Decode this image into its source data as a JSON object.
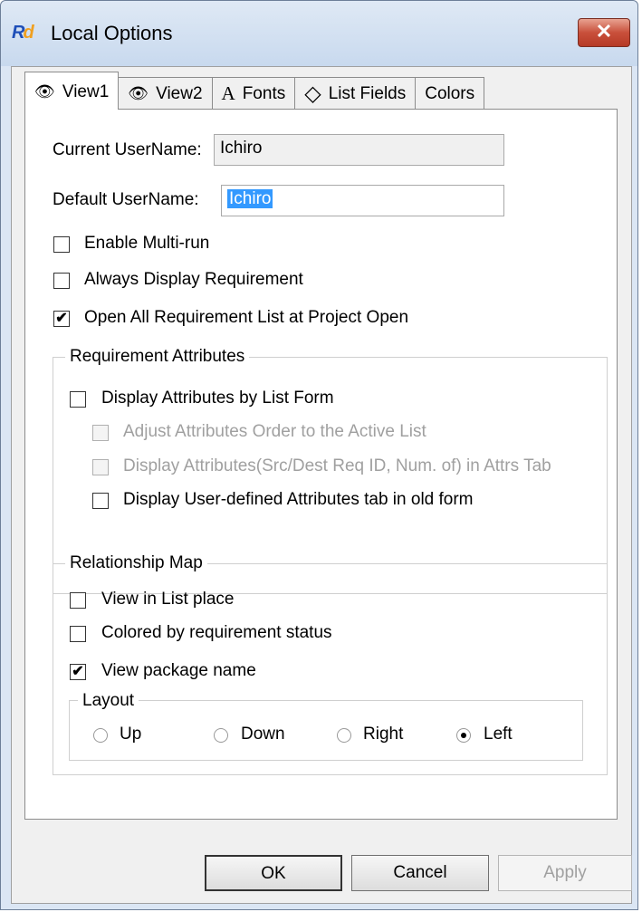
{
  "window": {
    "title": "Local Options",
    "close_glyph": "✕",
    "app_icon": "rd-app-icon"
  },
  "tabs": [
    {
      "label": "View1",
      "icon": "eye-icon",
      "active": true
    },
    {
      "label": "View2",
      "icon": "eye-icon",
      "active": false
    },
    {
      "label": "Fonts",
      "icon": "font-icon",
      "active": false
    },
    {
      "label": "List Fields",
      "icon": "diamond-icon",
      "active": false
    },
    {
      "label": "Colors",
      "icon": "",
      "active": false
    }
  ],
  "view1": {
    "current_username_label": "Current UserName:",
    "current_username_value": "Ichiro",
    "default_username_label": "Default UserName:",
    "default_username_value": "Ichiro",
    "options": [
      {
        "label": "Enable Multi-run",
        "checked": false
      },
      {
        "label": "Always Display Requirement",
        "checked": false
      },
      {
        "label": "Open All Requirement List at Project Open",
        "checked": true
      }
    ],
    "requirement_attributes": {
      "title": "Requirement Attributes",
      "items": [
        {
          "label": "Display Attributes by List Form",
          "checked": false,
          "enabled": true
        },
        {
          "label": "Adjust Attributes Order to the Active List",
          "checked": false,
          "enabled": false
        },
        {
          "label": "Display Attributes(Src/Dest Req ID, Num. of) in Attrs Tab",
          "checked": false,
          "enabled": false
        },
        {
          "label": "Display User-defined Attributes tab in old form",
          "checked": false,
          "enabled": true
        }
      ]
    },
    "relationship_map": {
      "title": "Relationship Map",
      "items": [
        {
          "label": "View in List place",
          "checked": false
        },
        {
          "label": "Colored by requirement status",
          "checked": false
        },
        {
          "label": "View package name",
          "checked": true
        }
      ],
      "layout": {
        "title": "Layout",
        "options": [
          "Up",
          "Down",
          "Right",
          "Left"
        ],
        "selected": "Left"
      }
    }
  },
  "buttons": {
    "ok": "OK",
    "cancel": "Cancel",
    "apply": "Apply"
  },
  "check_glyph": "✔"
}
